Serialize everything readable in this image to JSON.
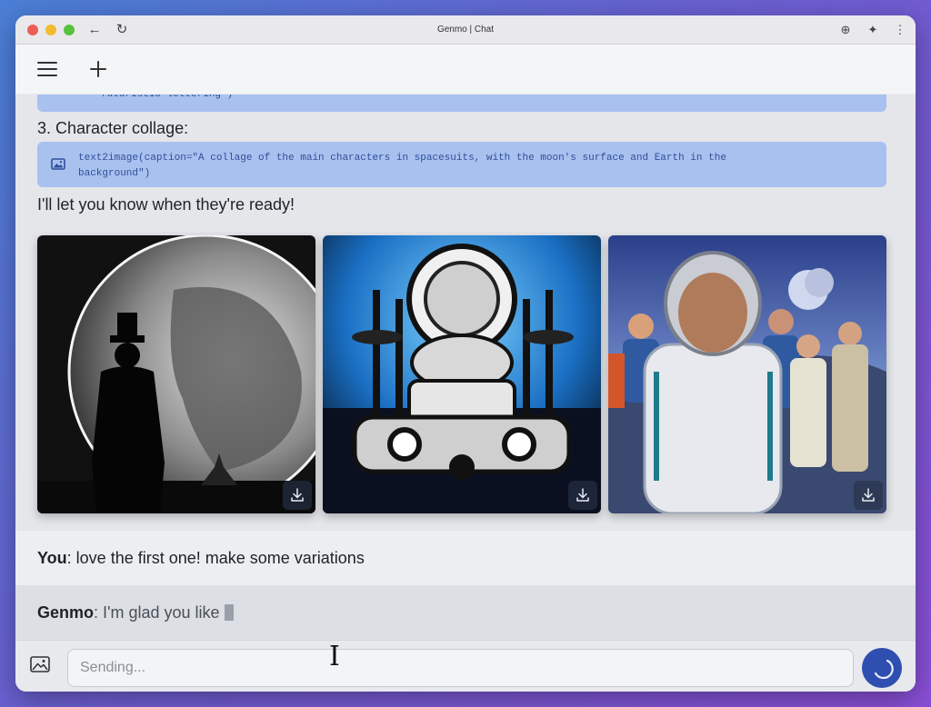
{
  "window": {
    "title": "Genmo | Chat"
  },
  "toolbar": {
    "back_icon": "←",
    "reload_icon": "↻",
    "zoom_icon": "⊕",
    "ext_icon": "✦",
    "more_icon": "⋮"
  },
  "header": {
    "menu_icon": "hamburger-icon",
    "new_icon": "plus-icon"
  },
  "chat": {
    "prev_code_tail": "futuristic lettering\")",
    "section3_label": "3. Character collage:",
    "code3": "text2image(caption=\"A collage of the main characters in spacesuits, with the moon's surface and Earth in the\nbackground\")",
    "ready_text": "I'll let you know when they're ready!",
    "images": [
      {
        "alt": "silhouette-man-moon"
      },
      {
        "alt": "retro-space-vehicle"
      },
      {
        "alt": "astronaut-crew"
      }
    ],
    "user_msg": {
      "speaker": "You",
      "text": ": love the first one! make some variations"
    },
    "genmo_msg": {
      "speaker": "Genmo",
      "text": ": I'm glad you like"
    }
  },
  "input": {
    "placeholder": "Sending...",
    "value": ""
  },
  "colors": {
    "accent": "#2f4fb0",
    "code_bg": "#a9c1ef",
    "code_text": "#2f4f9a"
  }
}
